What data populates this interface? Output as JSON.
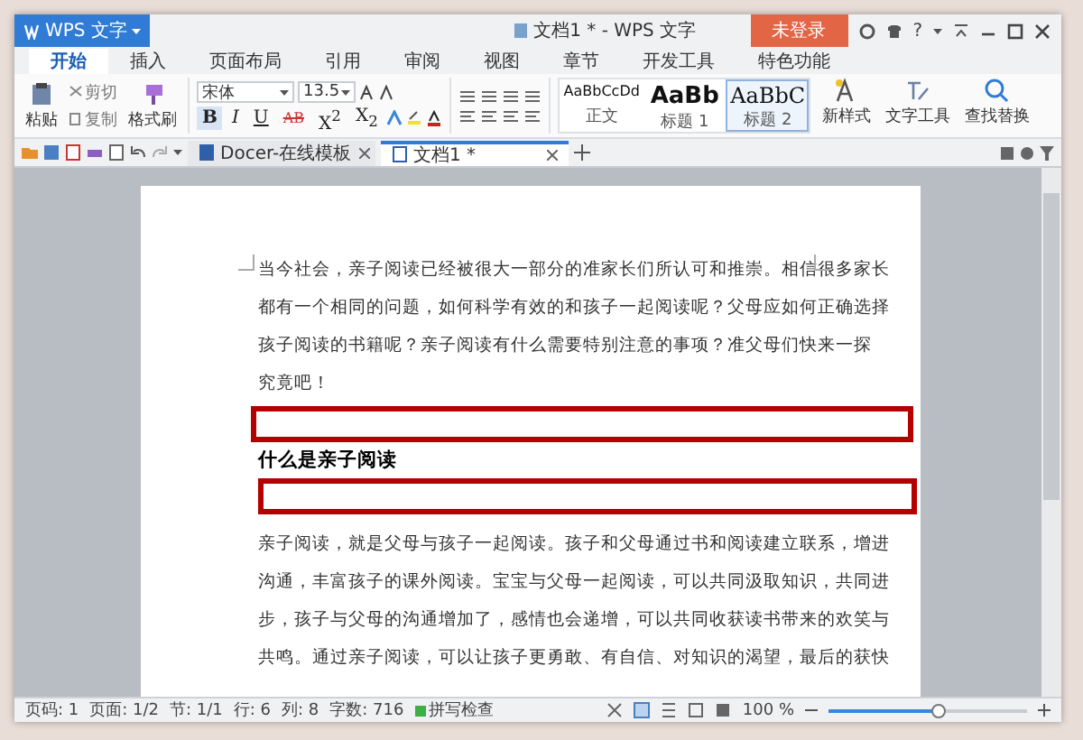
{
  "app_menu": {
    "label": "WPS 文字"
  },
  "window": {
    "title": "文档1 * - WPS 文字"
  },
  "login_button": {
    "label": "未登录"
  },
  "help": {
    "label": "?"
  },
  "tabs": [
    {
      "label": "开始",
      "selected": true
    },
    {
      "label": "插入",
      "selected": false
    },
    {
      "label": "页面布局",
      "selected": false
    },
    {
      "label": "引用",
      "selected": false
    },
    {
      "label": "审阅",
      "selected": false
    },
    {
      "label": "视图",
      "selected": false
    },
    {
      "label": "章节",
      "selected": false
    },
    {
      "label": "开发工具",
      "selected": false
    },
    {
      "label": "特色功能",
      "selected": false
    }
  ],
  "clipboard": {
    "paste": "粘贴",
    "cut": "剪切",
    "copy": "复制",
    "format_painter": "格式刷"
  },
  "font": {
    "family": "宋体",
    "size": "13.5"
  },
  "format_buttons": [
    {
      "kind": "bold",
      "label": "B"
    },
    {
      "kind": "italic",
      "label": "I"
    },
    {
      "kind": "underline",
      "label": "U"
    },
    {
      "kind": "strike",
      "label": "AB"
    },
    {
      "kind": "plain",
      "label": "X$^{2}$"
    },
    {
      "kind": "plain",
      "label": "X$_{2}$"
    }
  ],
  "styles": [
    {
      "kind": "body",
      "preview": "AaBbCcDd",
      "label": "正文",
      "selected": false
    },
    {
      "kind": "heading1",
      "preview": "AaBb",
      "label": "标题 1",
      "selected": false
    },
    {
      "kind": "heading2",
      "preview": "AaBbC",
      "label": "标题 2",
      "selected": true
    }
  ],
  "new_style": {
    "label": "新样式"
  },
  "text_tools": {
    "label": "文字工具"
  },
  "find_replace": {
    "label": "查找替换"
  },
  "doc_tabs": [
    {
      "label": "Docer-在线模板",
      "selected": false
    },
    {
      "label": "文档1 *",
      "selected": true
    }
  ],
  "document": {
    "blocks": [
      {
        "kind": "paragraph",
        "lines": [
          "当今社会，亲子阅读已经被很大一部分的准家长们所认可和推崇。相信很多家长",
          "都有一个相同的问题，如何科学有效的和孩子一起阅读呢？父母应如何正确选择",
          "孩子阅读的书籍呢？亲子阅读有什么需要特别注意的事项？准父母们快来一探",
          "究竟吧！"
        ]
      },
      {
        "kind": "highlight"
      },
      {
        "kind": "heading",
        "text": "什么是亲子阅读"
      },
      {
        "kind": "highlight"
      },
      {
        "kind": "paragraph",
        "lines": [
          "亲子阅读，就是父母与孩子一起阅读。孩子和父母通过书和阅读建立联系，增进",
          "沟通，丰富孩子的课外阅读。宝宝与父母一起阅读，可以共同汲取知识，共同进",
          "步，孩子与父母的沟通增加了，感情也会递增，可以共同收获读书带来的欢笑与",
          "共鸣。通过亲子阅读，可以让孩子更勇敢、有自信、对知识的渴望，最后的获快"
        ]
      }
    ]
  },
  "status_bar": {
    "items": [
      "页码: 1",
      "页面: 1/2",
      "节: 1/1",
      "行: 6",
      "列: 8",
      "字数: 716"
    ],
    "spell_check": "拼写检查",
    "zoom": "100 %"
  },
  "zoom_slider": {
    "level": 0.55
  }
}
